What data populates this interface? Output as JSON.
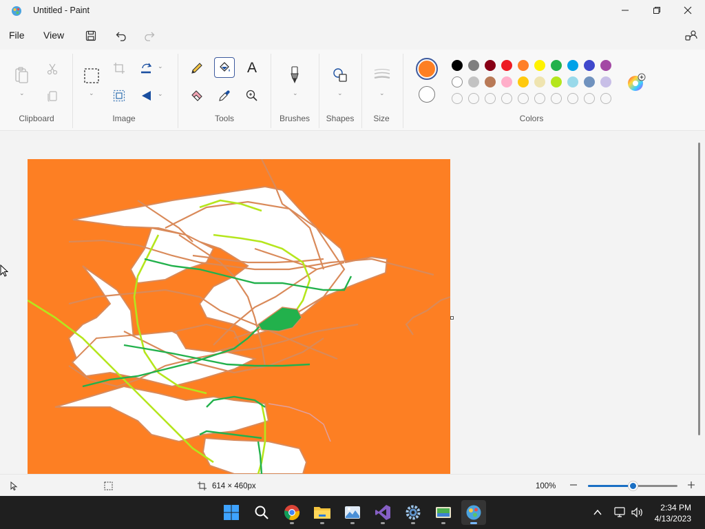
{
  "window": {
    "title": "Untitled - Paint",
    "minimize_icon": "minimize-icon",
    "maximize_icon": "restore-icon",
    "close_icon": "close-icon"
  },
  "menu": {
    "file": "File",
    "view": "View",
    "quick_access": [
      "save-icon",
      "undo-icon",
      "redo-icon"
    ]
  },
  "ribbon": {
    "groups": {
      "clipboard": "Clipboard",
      "image": "Image",
      "tools": "Tools",
      "brushes": "Brushes",
      "shapes": "Shapes",
      "size": "Size",
      "colors": "Colors"
    },
    "tools": {
      "text_glyph": "A",
      "active_tool": "fill-icon"
    },
    "primary_color": "#fd7f23",
    "secondary_color": "#ffffff",
    "palette_row1": [
      "#000000",
      "#7f7f7f",
      "#880015",
      "#ed1c24",
      "#ff7f27",
      "#fff200",
      "#22b14c",
      "#00a2e8",
      "#3f48cc",
      "#a349a4"
    ],
    "palette_row2": [
      "#ffffff",
      "#c3c3c3",
      "#b97a57",
      "#ffaec9",
      "#ffc90e",
      "#efe4b0",
      "#b5e61d",
      "#99d9ea",
      "#7092be",
      "#c8bfe7"
    ],
    "palette_row3_count": 10
  },
  "canvas": {
    "background": "#fd7f23"
  },
  "status": {
    "canvas_size": "614 × 460px",
    "zoom": "100%",
    "zoom_fraction": 0.5
  },
  "taskbar": {
    "apps": [
      "start-icon",
      "search-icon",
      "chrome-icon",
      "file-explorer-icon",
      "photos-icon",
      "visual-studio-icon",
      "settings-icon",
      "gallery-icon",
      "paint-icon"
    ],
    "time": "2:34 PM",
    "date": "4/13/2023"
  }
}
